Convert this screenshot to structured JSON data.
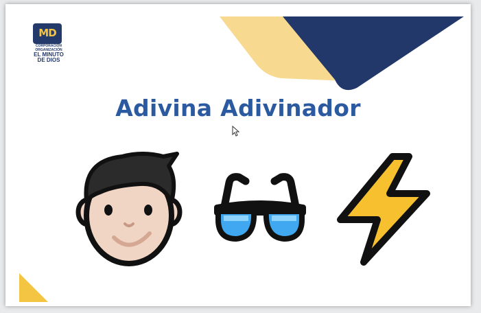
{
  "slide": {
    "title": "Adivina Adivinador",
    "logo": {
      "mark": "MD",
      "line1": "CORPORACIÓN",
      "line2": "ORGANIZACIÓN",
      "line3": "EL MINUTO",
      "line4": "DE DIOS"
    },
    "emojis": [
      "boy-face-icon",
      "sunglasses-icon",
      "lightning-icon"
    ],
    "colors": {
      "navy": "#22386b",
      "yellow": "#f7d98f",
      "title": "#2c5aa0"
    }
  }
}
